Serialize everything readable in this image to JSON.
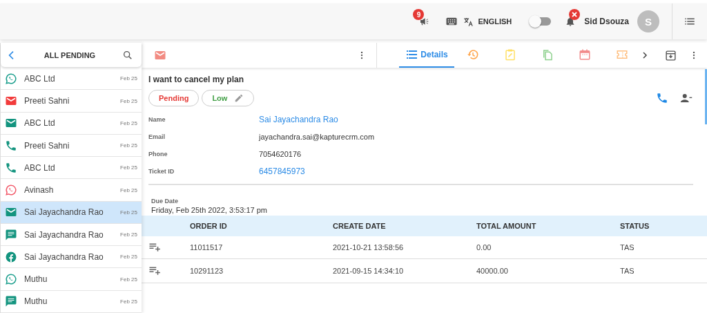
{
  "topbar": {
    "announcement_badge": "9",
    "language": "ENGLISH",
    "toggle_on": false,
    "user_name": "Sid Dsouza",
    "avatar_initial": "S"
  },
  "list": {
    "title": "ALL PENDING",
    "items": [
      {
        "kind": "whatsapp",
        "color": "#1a9e8c",
        "name": "ABC Ltd",
        "date": "Feb 25",
        "selected": false
      },
      {
        "kind": "email",
        "color": "#f23b3b",
        "name": "Preeti Sahni",
        "date": "Feb 25",
        "selected": false
      },
      {
        "kind": "email",
        "color": "#13947f",
        "name": "ABC Ltd",
        "date": "Feb 25",
        "selected": false
      },
      {
        "kind": "call",
        "color": "#13947f",
        "name": "Preeti Sahni",
        "date": "Feb 25",
        "selected": false
      },
      {
        "kind": "call",
        "color": "#13947f",
        "name": "ABC Ltd",
        "date": "Feb 25",
        "selected": false
      },
      {
        "kind": "whatsapp",
        "color": "#f25b6b",
        "name": "Avinash",
        "date": "Feb 25",
        "selected": false
      },
      {
        "kind": "email",
        "color": "#13947f",
        "name": "Sai Jayachandra Rao",
        "date": "Feb 25",
        "selected": true
      },
      {
        "kind": "chat",
        "color": "#13947f",
        "name": "Sai Jayachandra Rao",
        "date": "Feb 25",
        "selected": false
      },
      {
        "kind": "facebook",
        "color": "#13947f",
        "name": "Sai Jayachandra Rao",
        "date": "Feb 25",
        "selected": false
      },
      {
        "kind": "whatsapp",
        "color": "#1a9e8c",
        "name": "Muthu",
        "date": "Feb 25",
        "selected": false
      },
      {
        "kind": "chat",
        "color": "#13947f",
        "name": "Muthu",
        "date": "Feb 25",
        "selected": false
      }
    ]
  },
  "tabs": [
    {
      "kind": "details",
      "label": "Details",
      "color": "#2d8ce6",
      "selected": true
    },
    {
      "kind": "history",
      "color": "#ffa64d",
      "selected": false
    },
    {
      "kind": "note",
      "color": "#ffe066",
      "selected": false
    },
    {
      "kind": "copy",
      "color": "#8fd18f",
      "selected": false
    },
    {
      "kind": "calendar",
      "color": "#f28b8b",
      "selected": false
    },
    {
      "kind": "ticket",
      "color": "#ffbf80",
      "selected": false
    }
  ],
  "ticket": {
    "subject": "I want to cancel my plan",
    "status": "Pending",
    "priority": "Low",
    "fields": [
      {
        "label": "Name",
        "value": "Sai Jayachandra Rao",
        "kind": "link"
      },
      {
        "label": "Email",
        "value": "jayachandra.sai@kapturecrm.com",
        "kind": "text"
      },
      {
        "label": "Phone",
        "value": "7054620176",
        "kind": "text"
      },
      {
        "label": "Ticket ID",
        "value": "6457845973",
        "kind": "link"
      }
    ],
    "due_label": "Due Date",
    "due_value": "Friday, Feb 25th 2022, 3:53:17 pm"
  },
  "orders": {
    "columns": [
      "ORDER ID",
      "CREATE DATE",
      "TOTAL AMOUNT",
      "STATUS"
    ],
    "rows": [
      [
        "11011517",
        "2021-10-21 13:58:56",
        "0.00",
        "TAS"
      ],
      [
        "10291123",
        "2021-09-15 14:34:10",
        "40000.00",
        "TAS"
      ]
    ]
  }
}
